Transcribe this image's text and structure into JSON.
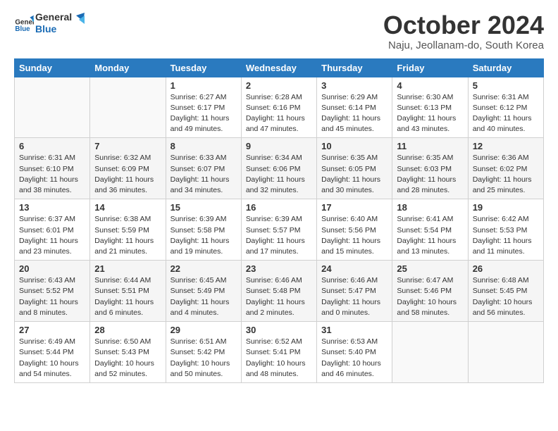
{
  "header": {
    "logo_line1": "General",
    "logo_line2": "Blue",
    "month_title": "October 2024",
    "subtitle": "Naju, Jeollanam-do, South Korea"
  },
  "days_of_week": [
    "Sunday",
    "Monday",
    "Tuesday",
    "Wednesday",
    "Thursday",
    "Friday",
    "Saturday"
  ],
  "weeks": [
    [
      {
        "day": "",
        "info": ""
      },
      {
        "day": "",
        "info": ""
      },
      {
        "day": "1",
        "info": "Sunrise: 6:27 AM\nSunset: 6:17 PM\nDaylight: 11 hours and 49 minutes."
      },
      {
        "day": "2",
        "info": "Sunrise: 6:28 AM\nSunset: 6:16 PM\nDaylight: 11 hours and 47 minutes."
      },
      {
        "day": "3",
        "info": "Sunrise: 6:29 AM\nSunset: 6:14 PM\nDaylight: 11 hours and 45 minutes."
      },
      {
        "day": "4",
        "info": "Sunrise: 6:30 AM\nSunset: 6:13 PM\nDaylight: 11 hours and 43 minutes."
      },
      {
        "day": "5",
        "info": "Sunrise: 6:31 AM\nSunset: 6:12 PM\nDaylight: 11 hours and 40 minutes."
      }
    ],
    [
      {
        "day": "6",
        "info": "Sunrise: 6:31 AM\nSunset: 6:10 PM\nDaylight: 11 hours and 38 minutes."
      },
      {
        "day": "7",
        "info": "Sunrise: 6:32 AM\nSunset: 6:09 PM\nDaylight: 11 hours and 36 minutes."
      },
      {
        "day": "8",
        "info": "Sunrise: 6:33 AM\nSunset: 6:07 PM\nDaylight: 11 hours and 34 minutes."
      },
      {
        "day": "9",
        "info": "Sunrise: 6:34 AM\nSunset: 6:06 PM\nDaylight: 11 hours and 32 minutes."
      },
      {
        "day": "10",
        "info": "Sunrise: 6:35 AM\nSunset: 6:05 PM\nDaylight: 11 hours and 30 minutes."
      },
      {
        "day": "11",
        "info": "Sunrise: 6:35 AM\nSunset: 6:03 PM\nDaylight: 11 hours and 28 minutes."
      },
      {
        "day": "12",
        "info": "Sunrise: 6:36 AM\nSunset: 6:02 PM\nDaylight: 11 hours and 25 minutes."
      }
    ],
    [
      {
        "day": "13",
        "info": "Sunrise: 6:37 AM\nSunset: 6:01 PM\nDaylight: 11 hours and 23 minutes."
      },
      {
        "day": "14",
        "info": "Sunrise: 6:38 AM\nSunset: 5:59 PM\nDaylight: 11 hours and 21 minutes."
      },
      {
        "day": "15",
        "info": "Sunrise: 6:39 AM\nSunset: 5:58 PM\nDaylight: 11 hours and 19 minutes."
      },
      {
        "day": "16",
        "info": "Sunrise: 6:39 AM\nSunset: 5:57 PM\nDaylight: 11 hours and 17 minutes."
      },
      {
        "day": "17",
        "info": "Sunrise: 6:40 AM\nSunset: 5:56 PM\nDaylight: 11 hours and 15 minutes."
      },
      {
        "day": "18",
        "info": "Sunrise: 6:41 AM\nSunset: 5:54 PM\nDaylight: 11 hours and 13 minutes."
      },
      {
        "day": "19",
        "info": "Sunrise: 6:42 AM\nSunset: 5:53 PM\nDaylight: 11 hours and 11 minutes."
      }
    ],
    [
      {
        "day": "20",
        "info": "Sunrise: 6:43 AM\nSunset: 5:52 PM\nDaylight: 11 hours and 8 minutes."
      },
      {
        "day": "21",
        "info": "Sunrise: 6:44 AM\nSunset: 5:51 PM\nDaylight: 11 hours and 6 minutes."
      },
      {
        "day": "22",
        "info": "Sunrise: 6:45 AM\nSunset: 5:49 PM\nDaylight: 11 hours and 4 minutes."
      },
      {
        "day": "23",
        "info": "Sunrise: 6:46 AM\nSunset: 5:48 PM\nDaylight: 11 hours and 2 minutes."
      },
      {
        "day": "24",
        "info": "Sunrise: 6:46 AM\nSunset: 5:47 PM\nDaylight: 11 hours and 0 minutes."
      },
      {
        "day": "25",
        "info": "Sunrise: 6:47 AM\nSunset: 5:46 PM\nDaylight: 10 hours and 58 minutes."
      },
      {
        "day": "26",
        "info": "Sunrise: 6:48 AM\nSunset: 5:45 PM\nDaylight: 10 hours and 56 minutes."
      }
    ],
    [
      {
        "day": "27",
        "info": "Sunrise: 6:49 AM\nSunset: 5:44 PM\nDaylight: 10 hours and 54 minutes."
      },
      {
        "day": "28",
        "info": "Sunrise: 6:50 AM\nSunset: 5:43 PM\nDaylight: 10 hours and 52 minutes."
      },
      {
        "day": "29",
        "info": "Sunrise: 6:51 AM\nSunset: 5:42 PM\nDaylight: 10 hours and 50 minutes."
      },
      {
        "day": "30",
        "info": "Sunrise: 6:52 AM\nSunset: 5:41 PM\nDaylight: 10 hours and 48 minutes."
      },
      {
        "day": "31",
        "info": "Sunrise: 6:53 AM\nSunset: 5:40 PM\nDaylight: 10 hours and 46 minutes."
      },
      {
        "day": "",
        "info": ""
      },
      {
        "day": "",
        "info": ""
      }
    ]
  ]
}
